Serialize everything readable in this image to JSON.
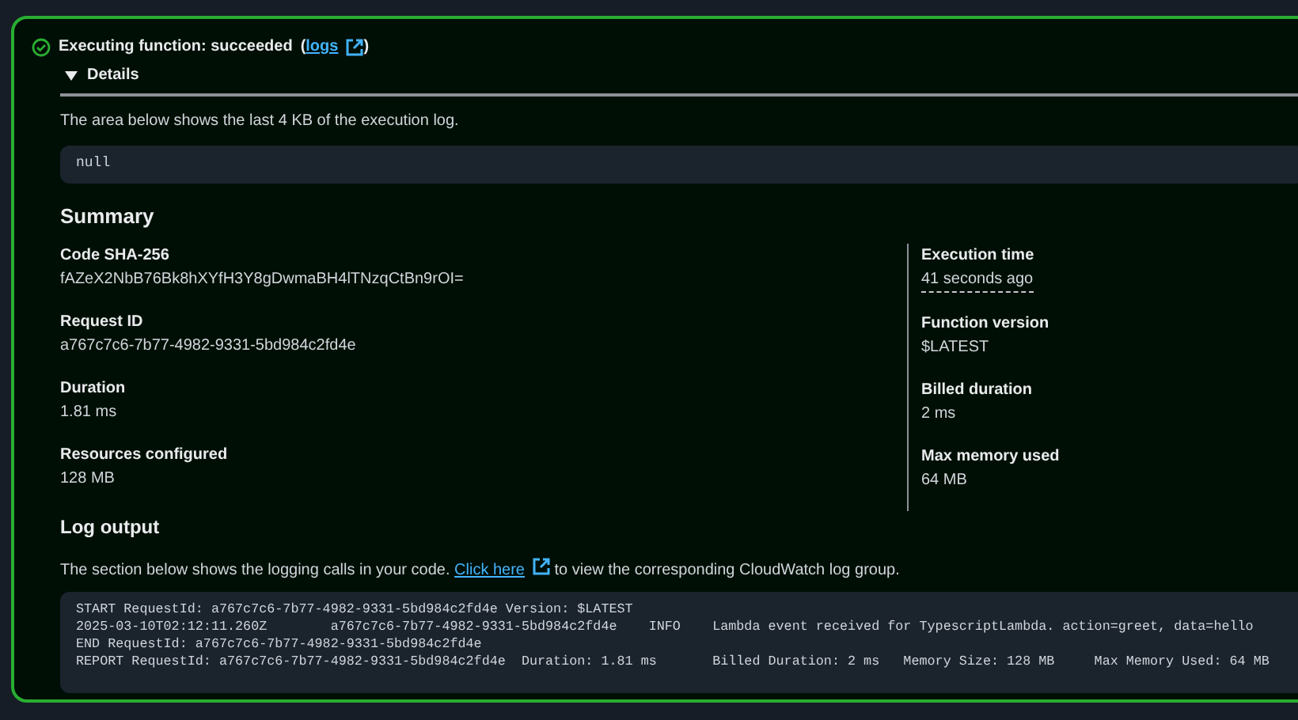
{
  "status": {
    "text": "Executing function: succeeded",
    "link": "logs",
    "open": "(",
    "close": ")"
  },
  "details": {
    "label": "Details",
    "expanded": true,
    "description": "The area below shows the last 4 KB of the execution log.",
    "result": "null"
  },
  "summary": {
    "title": "Summary",
    "left": [
      {
        "label": "Code SHA-256",
        "value": "fAZeX2NbB76Bk8hXYfH3Y8gDwmaBH4lTNzqCtBn9rOI="
      },
      {
        "label": "Request ID",
        "value": "a767c7c6-7b77-4982-9331-5bd984c2fd4e"
      },
      {
        "label": "Duration",
        "value": "1.81 ms"
      },
      {
        "label": "Resources configured",
        "value": "128 MB"
      }
    ],
    "right": [
      {
        "label": "Execution time",
        "value": "41 seconds ago",
        "kind": "time"
      },
      {
        "label": "Function version",
        "value": "$LATEST",
        "kind": "plain"
      },
      {
        "label": "Billed duration",
        "value": "2 ms",
        "kind": "plain"
      },
      {
        "label": "Max memory used",
        "value": "64 MB",
        "kind": "plain"
      }
    ]
  },
  "log": {
    "title": "Log output",
    "before": "The section below shows the logging calls in your code.",
    "link": "Click here",
    "after": "to view the corresponding CloudWatch log group.",
    "lines": [
      "START RequestId: a767c7c6-7b77-4982-9331-5bd984c2fd4e Version: $LATEST",
      "2025-03-10T02:12:11.260Z        a767c7c6-7b77-4982-9331-5bd984c2fd4e    INFO    Lambda event received for TypescriptLambda. action=greet, data=hello",
      "END RequestId: a767c7c6-7b77-4982-9331-5bd984c2fd4e",
      "REPORT RequestId: a767c7c6-7b77-4982-9331-5bd984c2fd4e  Duration: 1.81 ms       Billed Duration: 2 ms   Memory Size: 128 MB     Max Memory Used: 64 MB"
    ]
  }
}
